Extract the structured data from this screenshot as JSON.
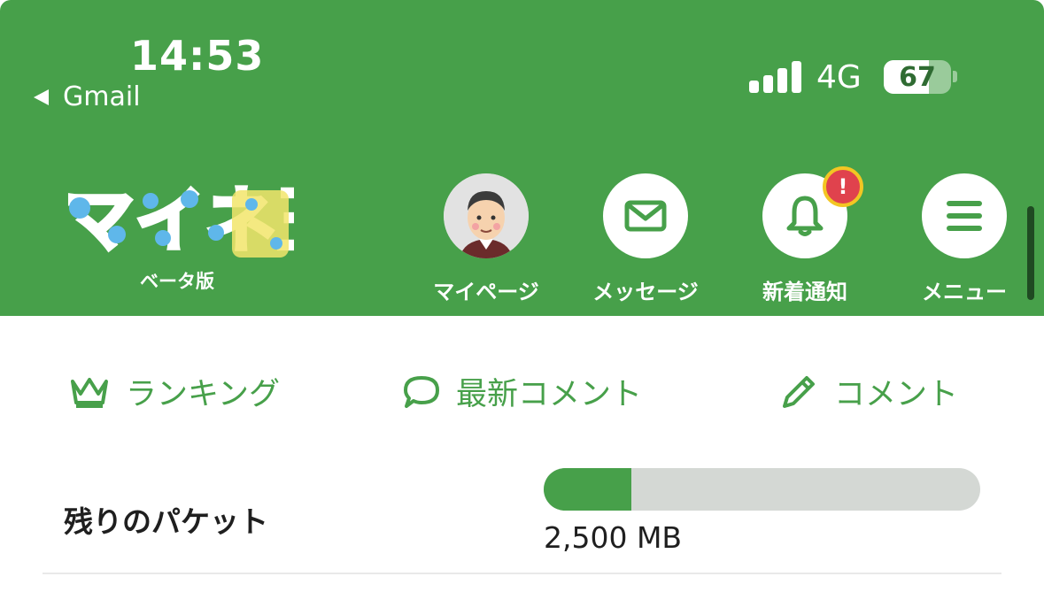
{
  "status_bar": {
    "time": "14:53",
    "back_app": "Gmail",
    "network": "4G",
    "battery_percent": "67",
    "signal_bars": 4
  },
  "header": {
    "logo_text": "マイネ王",
    "beta_label": "ベータ版",
    "nav": [
      {
        "label": "マイページ",
        "icon": "avatar"
      },
      {
        "label": "メッセージ",
        "icon": "envelope-icon"
      },
      {
        "label": "新着通知",
        "icon": "bell-icon",
        "badge": "!"
      },
      {
        "label": "メニュー",
        "icon": "menu-icon"
      }
    ]
  },
  "tabs": [
    {
      "label": "ランキング",
      "icon": "crown-icon"
    },
    {
      "label": "最新コメント",
      "icon": "speech-bubble-icon"
    },
    {
      "label": "コメント",
      "icon": "pencil-icon"
    }
  ],
  "packet": {
    "label": "残りのパケット",
    "value_text": "2,500 MB",
    "remaining_fraction": 0.2
  },
  "colors": {
    "brand_green": "#47a04a",
    "badge_red": "#e0424d",
    "badge_border": "#f3c623",
    "progress_track": "#d4d8d4"
  }
}
